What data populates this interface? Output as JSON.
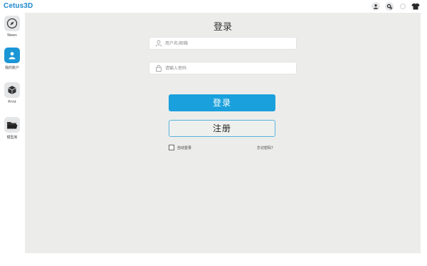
{
  "app": {
    "title": "Cetus3D"
  },
  "topbar": {
    "icons": [
      "user-icon",
      "gear-icon",
      "loading-spinner-icon",
      "tshirt-icon"
    ]
  },
  "sidebar": {
    "items": [
      {
        "label": "News",
        "icon": "compass-icon",
        "active": false
      },
      {
        "label": "我的账户",
        "icon": "user-icon",
        "active": true
      },
      {
        "label": "Print",
        "icon": "cube-icon",
        "active": false
      },
      {
        "label": "模型库",
        "icon": "folder-icon",
        "active": false
      }
    ]
  },
  "login": {
    "title": "登录",
    "username_placeholder": "用户名/邮箱",
    "password_placeholder": "请输入密码",
    "login_button": "登录",
    "register_button": "注册",
    "auto_login_label": "自动登录",
    "forgot_password": "忘记密码?"
  },
  "colors": {
    "brand": "#1a86cc",
    "primary": "#1aa0dc",
    "background": "#ecedeb"
  }
}
